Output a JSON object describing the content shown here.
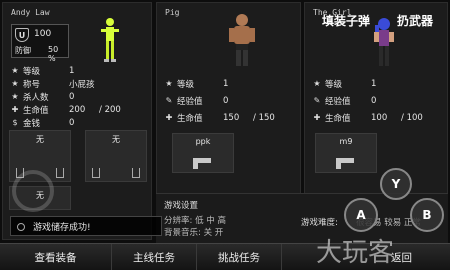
{
  "players": [
    {
      "name": "Andy Law",
      "shield": "100",
      "defense_label": "防御",
      "defense_value": "50",
      "defense_unit": "%",
      "stats": [
        {
          "icon": "★",
          "label": "等级",
          "value": "1",
          "max": ""
        },
        {
          "icon": "★",
          "label": "称号",
          "value": "小屁孩",
          "max": ""
        },
        {
          "icon": "★",
          "label": "杀人数",
          "value": "0",
          "max": ""
        },
        {
          "icon": "✚",
          "label": "生命值",
          "value": "200",
          "max": "/ 200"
        },
        {
          "icon": "$",
          "label": "金钱",
          "value": "0",
          "max": ""
        }
      ],
      "slots": [
        "无",
        "无",
        "无"
      ]
    },
    {
      "name": "Pig",
      "stats": [
        {
          "icon": "★",
          "label": "等级",
          "value": "1",
          "max": ""
        },
        {
          "icon": "✎",
          "label": "经验值",
          "value": "0",
          "max": ""
        },
        {
          "icon": "✚",
          "label": "生命值",
          "value": "150",
          "max": "/ 150"
        }
      ],
      "weapon": "ppk"
    },
    {
      "name": "The Girl",
      "stats": [
        {
          "icon": "★",
          "label": "等级",
          "value": "1",
          "max": ""
        },
        {
          "icon": "✎",
          "label": "经验值",
          "value": "0",
          "max": ""
        },
        {
          "icon": "✚",
          "label": "生命值",
          "value": "100",
          "max": "/ 100"
        }
      ],
      "weapon": "m9"
    }
  ],
  "top_buttons": {
    "reload": "填装子弹",
    "throw": "扔武器"
  },
  "settings": {
    "title": "游戏设置",
    "row1": "分辨率: 低  中  高",
    "row2": "背景音乐: 关  开",
    "difficulty_label": "游戏难度:",
    "difficulty_value": "很容易  较易  正常"
  },
  "controls": {
    "y": "Y",
    "a": "A",
    "b": "B"
  },
  "toast": "游戏储存成功!",
  "tabs": [
    "查看装备",
    "主线任务",
    "挑战任务",
    "返回"
  ],
  "watermark": "大玩客"
}
